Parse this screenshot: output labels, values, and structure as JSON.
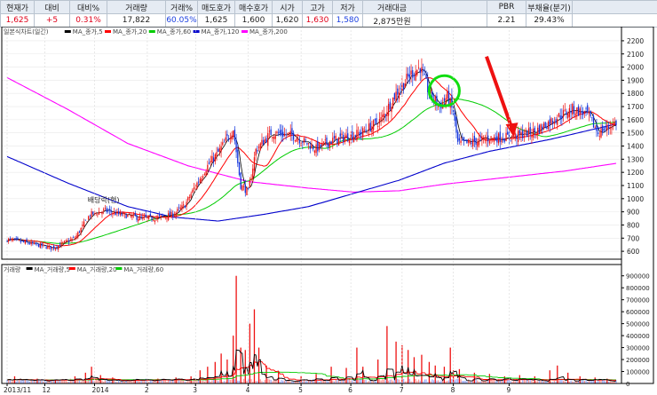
{
  "quote": {
    "headers": [
      "현재가",
      "대비",
      "대비%",
      "거래량",
      "거래%",
      "매도호가",
      "매수호가",
      "시가",
      "고가",
      "저가",
      "거래대금",
      "",
      "PBR",
      "부채율(분기)",
      ""
    ],
    "values": [
      "1,625",
      "+5",
      "0.31%",
      "17,822",
      "60.05%",
      "1,625",
      "1,600",
      "1,620",
      "1,630",
      "1,580",
      "2,875만원",
      "",
      "2.21",
      "29.43%",
      ""
    ],
    "value_colors": [
      "red",
      "red",
      "red",
      "",
      "blue",
      "",
      "",
      "",
      "red",
      "blue",
      "",
      "",
      "",
      "",
      ""
    ]
  },
  "chart_data": [
    {
      "type": "candlestick",
      "legend": [
        {
          "label": "일본식차트(일간)",
          "color": "#333333"
        },
        {
          "label": "MA_종가,5",
          "color": "#000000"
        },
        {
          "label": "MA_종가,20",
          "color": "#ff0000"
        },
        {
          "label": "MA_종가,60",
          "color": "#00cc00"
        },
        {
          "label": "MA_종가,120",
          "color": "#0000cc"
        },
        {
          "label": "MA_종가,200",
          "color": "#ff00ff"
        }
      ],
      "y_ticks": [
        2200,
        2100,
        2000,
        1900,
        1800,
        1700,
        1600,
        1500,
        1400,
        1300,
        1200,
        1100,
        1000,
        900,
        800,
        700,
        600
      ],
      "ylim": [
        540,
        2240
      ],
      "annotation": "배당락(현)",
      "x_ticks": [
        "2013/11",
        "12",
        "2014",
        "2",
        "3",
        "4",
        "5",
        "6",
        "7",
        "8",
        "9"
      ],
      "close_anchors": [
        [
          0,
          690
        ],
        [
          15,
          660
        ],
        [
          30,
          625
        ],
        [
          45,
          700
        ],
        [
          55,
          880
        ],
        [
          65,
          910
        ],
        [
          75,
          880
        ],
        [
          90,
          850
        ],
        [
          100,
          855
        ],
        [
          110,
          880
        ],
        [
          118,
          950
        ],
        [
          125,
          1100
        ],
        [
          133,
          1250
        ],
        [
          140,
          1350
        ],
        [
          150,
          1530
        ],
        [
          155,
          1100
        ],
        [
          160,
          1050
        ],
        [
          165,
          1370
        ],
        [
          175,
          1500
        ],
        [
          190,
          1480
        ],
        [
          205,
          1380
        ],
        [
          215,
          1440
        ],
        [
          235,
          1500
        ],
        [
          248,
          1600
        ],
        [
          258,
          1800
        ],
        [
          268,
          1950
        ],
        [
          274,
          2000
        ],
        [
          280,
          1800
        ],
        [
          287,
          1700
        ],
        [
          292,
          1780
        ],
        [
          296,
          1650
        ],
        [
          299,
          1420
        ],
        [
          305,
          1420
        ],
        [
          320,
          1460
        ],
        [
          335,
          1470
        ],
        [
          350,
          1510
        ],
        [
          365,
          1620
        ],
        [
          375,
          1680
        ],
        [
          385,
          1640
        ],
        [
          392,
          1500
        ],
        [
          398,
          1540
        ],
        [
          404,
          1580
        ]
      ],
      "ma5_color": "#000000",
      "ma20_color": "#ff0000",
      "ma60_color": "#00cc00",
      "ma120_color": "#0000cc",
      "ma200_color": "#ff00ff",
      "ma120_anchors": [
        [
          0,
          1320
        ],
        [
          40,
          1120
        ],
        [
          80,
          940
        ],
        [
          110,
          860
        ],
        [
          140,
          830
        ],
        [
          170,
          880
        ],
        [
          200,
          940
        ],
        [
          230,
          1040
        ],
        [
          260,
          1140
        ],
        [
          290,
          1270
        ],
        [
          320,
          1360
        ],
        [
          360,
          1450
        ],
        [
          405,
          1570
        ]
      ],
      "ma200_anchors": [
        [
          0,
          1920
        ],
        [
          40,
          1680
        ],
        [
          80,
          1420
        ],
        [
          120,
          1250
        ],
        [
          160,
          1130
        ],
        [
          200,
          1080
        ],
        [
          230,
          1050
        ],
        [
          260,
          1060
        ],
        [
          290,
          1110
        ],
        [
          330,
          1160
        ],
        [
          370,
          1210
        ],
        [
          405,
          1270
        ]
      ],
      "up_color": "#ee1111",
      "down_color": "#1133dd"
    },
    {
      "type": "bar",
      "legend": [
        {
          "label": "거래량",
          "color": "#333333"
        },
        {
          "label": "MA_거래량,5",
          "color": "#000000"
        },
        {
          "label": "MA_거래량,20",
          "color": "#ff0000"
        },
        {
          "label": "MA_거래량,60",
          "color": "#00cc00"
        }
      ],
      "y_ticks": [
        "900000",
        "800000",
        "700000",
        "600000",
        "500000",
        "400000",
        "300000",
        "200000",
        "100000",
        "0"
      ],
      "ylim": [
        0,
        950000
      ],
      "spikes": [
        [
          5,
          60000
        ],
        [
          20,
          40000
        ],
        [
          32,
          30000
        ],
        [
          45,
          60000
        ],
        [
          52,
          90000
        ],
        [
          56,
          140000
        ],
        [
          62,
          70000
        ],
        [
          70,
          50000
        ],
        [
          85,
          30000
        ],
        [
          100,
          40000
        ],
        [
          112,
          50000
        ],
        [
          122,
          60000
        ],
        [
          128,
          110000
        ],
        [
          133,
          140000
        ],
        [
          138,
          180000
        ],
        [
          142,
          250000
        ],
        [
          146,
          200000
        ],
        [
          150,
          400000
        ],
        [
          152,
          900000
        ],
        [
          155,
          300000
        ],
        [
          158,
          280000
        ],
        [
          161,
          500000
        ],
        [
          164,
          620000
        ],
        [
          167,
          300000
        ],
        [
          172,
          150000
        ],
        [
          180,
          100000
        ],
        [
          195,
          60000
        ],
        [
          205,
          80000
        ],
        [
          215,
          140000
        ],
        [
          225,
          130000
        ],
        [
          232,
          300000
        ],
        [
          236,
          140000
        ],
        [
          246,
          200000
        ],
        [
          252,
          480000
        ],
        [
          258,
          350000
        ],
        [
          262,
          320000
        ],
        [
          266,
          280000
        ],
        [
          270,
          220000
        ],
        [
          275,
          240000
        ],
        [
          280,
          180000
        ],
        [
          284,
          150000
        ],
        [
          290,
          140000
        ],
        [
          294,
          300000
        ],
        [
          296,
          110000
        ],
        [
          300,
          120000
        ],
        [
          310,
          90000
        ],
        [
          320,
          80000
        ],
        [
          330,
          60000
        ],
        [
          340,
          70000
        ],
        [
          350,
          60000
        ],
        [
          360,
          110000
        ],
        [
          365,
          150000
        ],
        [
          372,
          90000
        ],
        [
          380,
          60000
        ],
        [
          390,
          50000
        ],
        [
          398,
          40000
        ]
      ]
    }
  ]
}
